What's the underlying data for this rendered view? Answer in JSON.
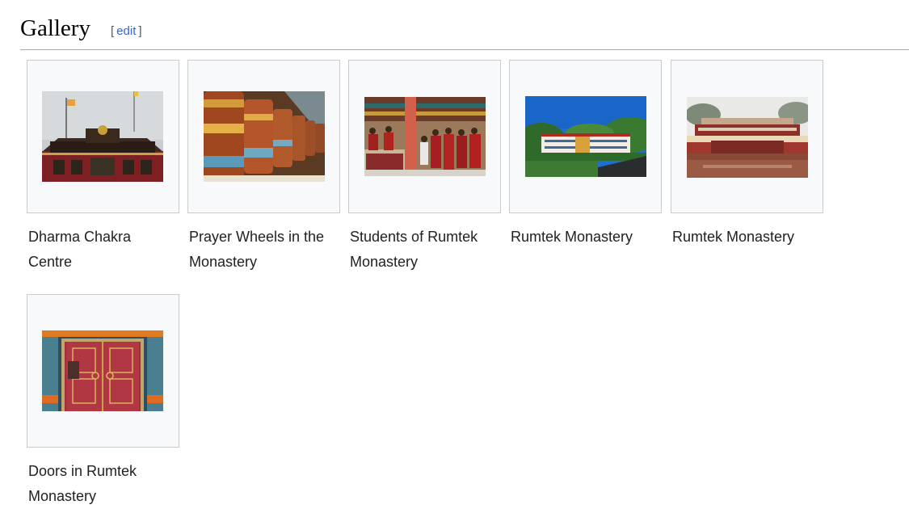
{
  "heading": {
    "title": "Gallery",
    "edit_label": "edit",
    "bracket_open": "[",
    "bracket_close": "]"
  },
  "gallery": [
    {
      "caption": "Dharma Chakra Centre"
    },
    {
      "caption": "Prayer Wheels in the Monastery"
    },
    {
      "caption": "Students of Rumtek Monastery"
    },
    {
      "caption": "Rumtek Monastery"
    },
    {
      "caption": "Rumtek Monastery"
    },
    {
      "caption": "Doors in Rumtek Monastery"
    }
  ]
}
